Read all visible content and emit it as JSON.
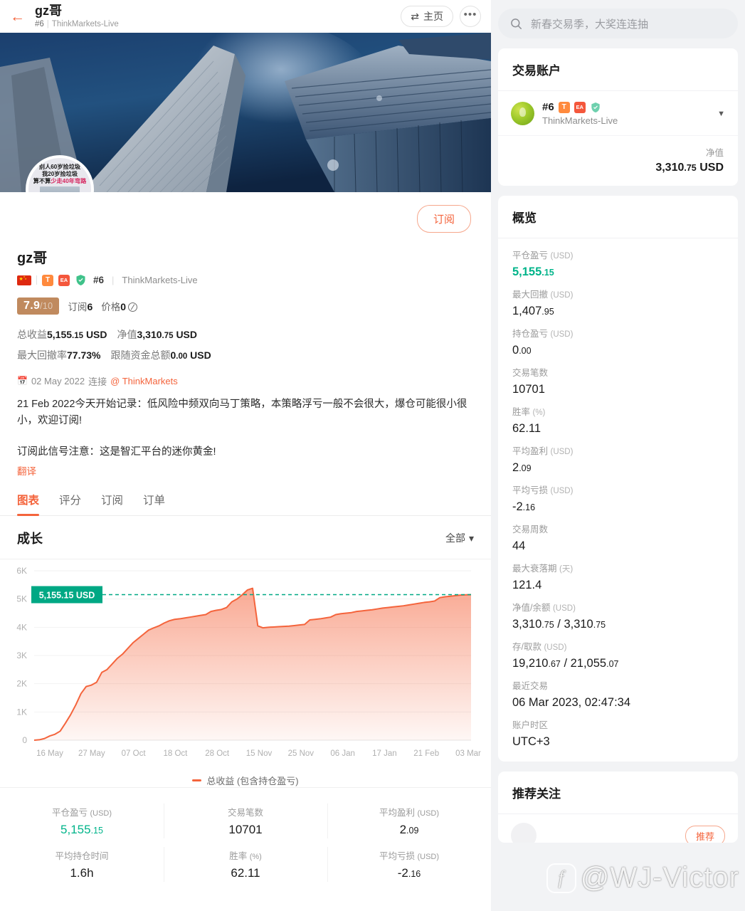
{
  "header": {
    "back_icon": "back-arrow-icon",
    "title": "gz哥",
    "rank": "#6",
    "server": "ThinkMarkets-Live",
    "home_button": "主页",
    "more_button": "•••"
  },
  "profile": {
    "name": "gz哥",
    "flag": "cn-flag-icon",
    "badge_t": "T",
    "badge_ea": "EA",
    "badge_shield": "verified-shield-icon",
    "rank": "#6",
    "server": "ThinkMarkets-Live",
    "score": "7.9",
    "score_denominator": "/10",
    "subscribers_label": "订阅",
    "subscribers_value": "6",
    "price_label": "价格",
    "price_value": "0",
    "subscribe_button": "订阅",
    "stat_total_label": "总收益",
    "stat_total_value": "5,155",
    "stat_total_dec": ".15",
    "stat_total_unit": "USD",
    "stat_equity_label": "净值",
    "stat_equity_value": "3,310",
    "stat_equity_dec": ".75",
    "stat_equity_unit": "USD",
    "stat_dd_label": "最大回撤率",
    "stat_dd_value": "77.73%",
    "stat_follow_label": "跟随资金总额",
    "stat_follow_value": "0",
    "stat_follow_dec": ".00",
    "stat_follow_unit": "USD",
    "connect_date": "02 May 2022",
    "connect_label": "连接",
    "broker": "@ ThinkMarkets",
    "description_1": "21 Feb 2022今天开始记录：低风险中频双向马丁策略，本策略浮亏一般不会很大，爆仓可能很小很小，欢迎订阅!",
    "description_2": "订阅此信号注意：这是智汇平台的迷你黄金!",
    "translate_link": "翻译",
    "avatar_line1": "别人60岁捡垃圾",
    "avatar_line2": "我20岁捡垃圾",
    "avatar_line3a": "算不算",
    "avatar_line3b": "少走40年弯路"
  },
  "tabs": [
    {
      "label": "图表",
      "active": true
    },
    {
      "label": "评分",
      "active": false
    },
    {
      "label": "订阅",
      "active": false
    },
    {
      "label": "订单",
      "active": false
    }
  ],
  "growth": {
    "title": "成长",
    "range_selector": "全部",
    "tooltip": "5,155.15 USD"
  },
  "chart_data": {
    "type": "area",
    "title": "成长",
    "xlabel": "",
    "ylabel": "",
    "ylim": [
      0,
      6000
    ],
    "yticks": [
      "0",
      "1K",
      "2K",
      "3K",
      "4K",
      "5K",
      "6K"
    ],
    "ytick_values": [
      0,
      1000,
      2000,
      3000,
      4000,
      5000,
      6000
    ],
    "xticks": [
      "16 May",
      "27 May",
      "07 Oct",
      "18 Oct",
      "28 Oct",
      "15 Nov",
      "25 Nov",
      "06 Jan",
      "17 Jan",
      "21 Feb",
      "03 Mar"
    ],
    "grid": true,
    "legend": "总收益 (包含持仓盈亏)",
    "legend_position": "bottom",
    "series": [
      {
        "name": "总收益 (包含持仓盈亏)",
        "color": "#f4643c",
        "values": [
          0,
          15,
          60,
          150,
          210,
          320,
          600,
          900,
          1250,
          1650,
          1900,
          1950,
          2050,
          2400,
          2500,
          2700,
          2900,
          3050,
          3250,
          3450,
          3600,
          3750,
          3900,
          3980,
          4050,
          4150,
          4230,
          4280,
          4300,
          4330,
          4360,
          4390,
          4420,
          4450,
          4560,
          4600,
          4630,
          4700,
          4900,
          5000,
          5150,
          5320,
          5380,
          4050,
          3980,
          4000,
          4010,
          4020,
          4030,
          4040,
          4060,
          4080,
          4100,
          4260,
          4280,
          4300,
          4330,
          4360,
          4450,
          4480,
          4500,
          4520,
          4560,
          4580,
          4600,
          4620,
          4650,
          4680,
          4700,
          4720,
          4740,
          4760,
          4790,
          4820,
          4850,
          4880,
          4900,
          4930,
          5050,
          5080,
          5100,
          5120,
          5140,
          5150,
          5155
        ]
      }
    ],
    "reference_line": {
      "value": 5155.15,
      "label": "5,155.15 USD",
      "color": "#00a884",
      "style": "dashed"
    }
  },
  "bottom_stats": [
    {
      "label": "平仓盈亏",
      "unit": "(USD)",
      "value": "5,155",
      "dec": ".15",
      "green": true
    },
    {
      "label": "交易笔数",
      "unit": "",
      "value": "10701",
      "dec": "",
      "green": false
    },
    {
      "label": "平均盈利",
      "unit": "(USD)",
      "value": "2",
      "dec": ".09",
      "green": false
    },
    {
      "label": "平均持仓时间",
      "unit": "",
      "value": "1.6h",
      "dec": "",
      "green": false
    },
    {
      "label": "胜率",
      "unit": "(%)",
      "value": "62.11",
      "dec": "",
      "green": false
    },
    {
      "label": "平均亏损",
      "unit": "(USD)",
      "value": "-2",
      "dec": ".16",
      "green": false
    }
  ],
  "sidebar": {
    "search_placeholder": "新春交易季，大奖连连抽",
    "account_card_title": "交易账户",
    "account_rank": "#6",
    "account_badge_t": "T",
    "account_badge_ea": "EA",
    "account_server": "ThinkMarkets-Live",
    "equity_label": "净值",
    "equity_value": "3,310",
    "equity_dec": ".75",
    "equity_unit": "USD",
    "overview_title": "概览",
    "overview_items": [
      {
        "label": "平仓盈亏",
        "unit": "(USD)",
        "value": "5,155",
        "dec": ".15",
        "green": true
      },
      {
        "label": "最大回撤",
        "unit": "(USD)",
        "value": "1,407",
        "dec": ".95",
        "green": false
      },
      {
        "label": "持仓盈亏",
        "unit": "(USD)",
        "value": "0",
        "dec": ".00",
        "green": false
      },
      {
        "label": "交易笔数",
        "unit": "",
        "value": "10701",
        "dec": "",
        "green": false
      },
      {
        "label": "胜率",
        "unit": "(%)",
        "value": "62.11",
        "dec": "",
        "green": false
      },
      {
        "label": "平均盈利",
        "unit": "(USD)",
        "value": "2",
        "dec": ".09",
        "green": false
      },
      {
        "label": "平均亏损",
        "unit": "(USD)",
        "value": "-2",
        "dec": ".16",
        "green": false
      },
      {
        "label": "交易周数",
        "unit": "",
        "value": "44",
        "dec": "",
        "green": false
      },
      {
        "label": "最大衰落期",
        "unit": "(天)",
        "value": "121.4",
        "dec": "",
        "green": false
      },
      {
        "label": "净值/余额",
        "unit": "(USD)",
        "value": "3,310",
        "dec": ".75",
        "value2": " / 3,310",
        "dec2": ".75",
        "green": false
      },
      {
        "label": "存/取款",
        "unit": "(USD)",
        "value": "19,210",
        "dec": ".67",
        "value2": " / 21,055",
        "dec2": ".07",
        "green": false
      },
      {
        "label": "最近交易",
        "unit": "",
        "value": "06 Mar 2023, 02:47:34",
        "dec": "",
        "green": false
      },
      {
        "label": "账户时区",
        "unit": "",
        "value": "UTC+3",
        "dec": "",
        "green": false
      }
    ],
    "recommend_title": "推荐关注",
    "recommend_button": "推荐"
  },
  "watermark": {
    "text": "@WJ-Victor",
    "logo": "f"
  },
  "colors": {
    "accent": "#f4643c",
    "green": "#00b48a",
    "teal": "#00a884",
    "score_chip": "#c08a5e"
  }
}
